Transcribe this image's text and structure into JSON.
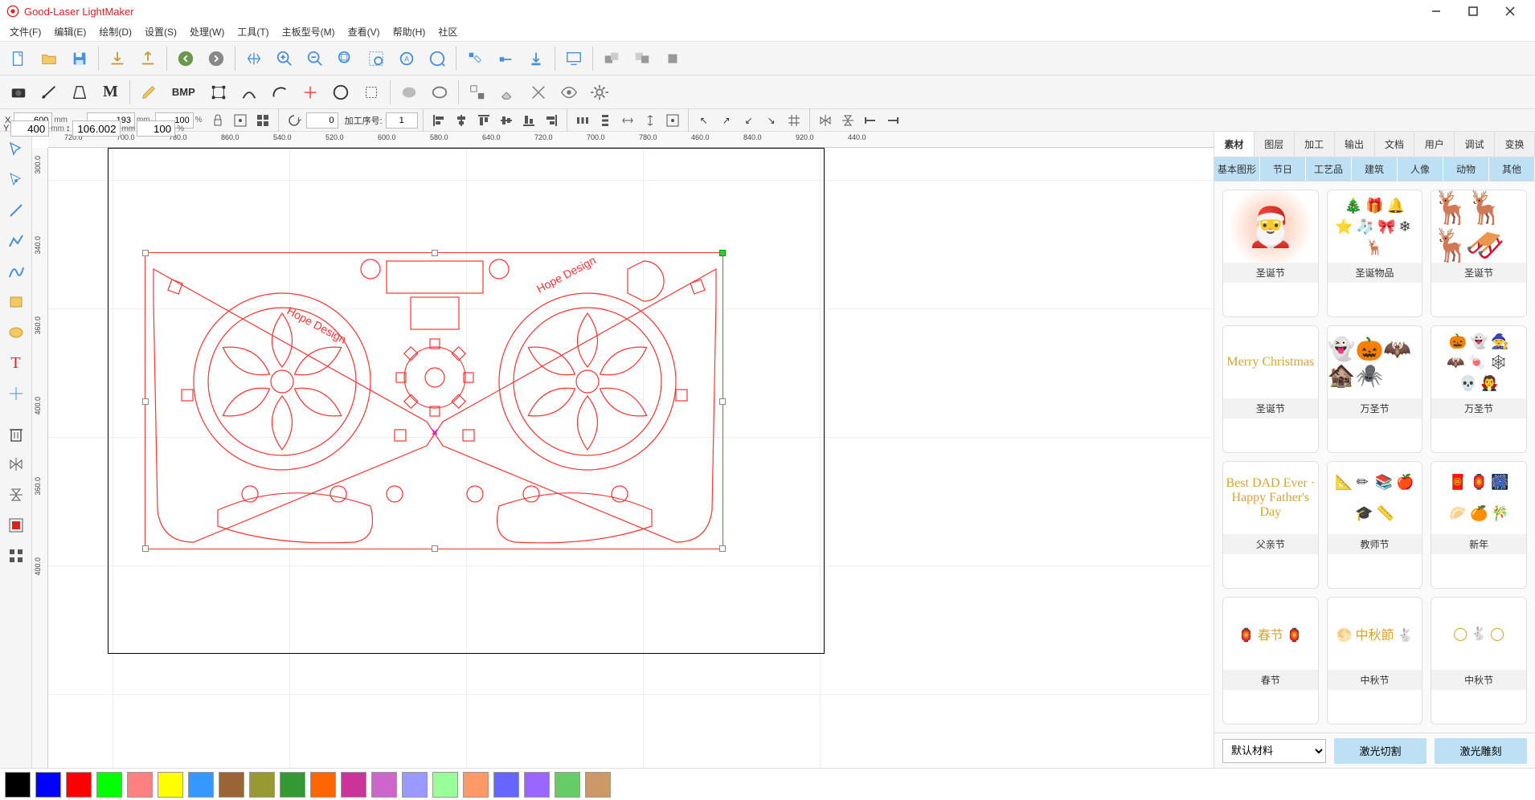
{
  "app": {
    "title": "Good-Laser LightMaker"
  },
  "menu": {
    "file": "文件(F)",
    "edit": "编辑(E)",
    "draw": "绘制(D)",
    "set": "设置(S)",
    "process": "处理(W)",
    "tool": "工具(T)",
    "board": "主板型号(M)",
    "view": "查看(V)",
    "help": "帮助(H)",
    "community": "社区"
  },
  "toolbar2": {
    "bmp": "BMP",
    "m": "M"
  },
  "params": {
    "x_label": "X",
    "x_val": "600",
    "x_unit": "mm",
    "y_label": "Y",
    "y_val": "400",
    "y_unit": "mm",
    "w_val": "193",
    "w_unit": "mm",
    "h_val": "106.002",
    "h_unit": "mm",
    "sx_val": "100",
    "sx_unit": "%",
    "sy_val": "100",
    "sy_unit": "%",
    "rot_val": "0",
    "seq_label": "加工序号:",
    "seq_val": "1"
  },
  "hruler": [
    "720.0",
    "700.0",
    "780.0",
    "860.0",
    "540.0",
    "520.0",
    "600.0",
    "580.0",
    "640.0",
    "720.0",
    "700.0",
    "780.0",
    "460.0",
    "840.0",
    "920.0",
    "440.0"
  ],
  "vruler": [
    "300.0",
    "340.0",
    "360.0",
    "400.0",
    "360.0",
    "400.0"
  ],
  "rp": {
    "tabs": [
      "素材",
      "图层",
      "加工",
      "输出",
      "文档",
      "用户",
      "调试",
      "变换"
    ],
    "subtabs": [
      "基本图形",
      "节日",
      "工艺品",
      "建筑",
      "人像",
      "动物",
      "其他"
    ],
    "cards": [
      {
        "cap": "圣诞节",
        "t": "santa"
      },
      {
        "cap": "圣诞物品",
        "t": "icons",
        "glyphs": "🎄🎁🔔⭐🧦🎀❄️🦌"
      },
      {
        "cap": "圣诞节",
        "t": "sleigh",
        "txt": "🦌🦌🦌🛷"
      },
      {
        "cap": "圣诞节",
        "t": "merry",
        "txt": "Merry Christmas"
      },
      {
        "cap": "万圣节",
        "t": "halloween",
        "glyphs": "👻🎃🦇🏚️🕷️"
      },
      {
        "cap": "万圣节",
        "t": "icons",
        "glyphs": "🎃👻🧙🦇🍬🕸️💀🧛"
      },
      {
        "cap": "父亲节",
        "t": "merry",
        "txt": "Best DAD Ever · Happy Father's Day"
      },
      {
        "cap": "教师节",
        "t": "icons",
        "glyphs": "📐✏️📚🍎🎓📏"
      },
      {
        "cap": "新年",
        "t": "icons",
        "glyphs": "🧧🏮🎆🥟🍊🎋"
      },
      {
        "cap": "春节",
        "t": "merry",
        "txt": "🏮 春节 🏮"
      },
      {
        "cap": "中秋节",
        "t": "merry",
        "txt": "🌕 中秋節 🐇"
      },
      {
        "cap": "中秋节",
        "t": "merry",
        "txt": "◯ 🐇 ◯"
      }
    ],
    "material_label": "默认材料",
    "btn_cut": "激光切割",
    "btn_engrave": "激光雕刻"
  },
  "colors": [
    "#000000",
    "#0000ff",
    "#ff0000",
    "#00ff00",
    "#ff8080",
    "#ffff00",
    "#3399ff",
    "#996633",
    "#999933",
    "#339933",
    "#ff6600",
    "#cc3399",
    "#cc66cc",
    "#9999ff",
    "#99ff99",
    "#ff9966",
    "#6666ff",
    "#9966ff",
    "#66cc66",
    "#cc9966"
  ]
}
